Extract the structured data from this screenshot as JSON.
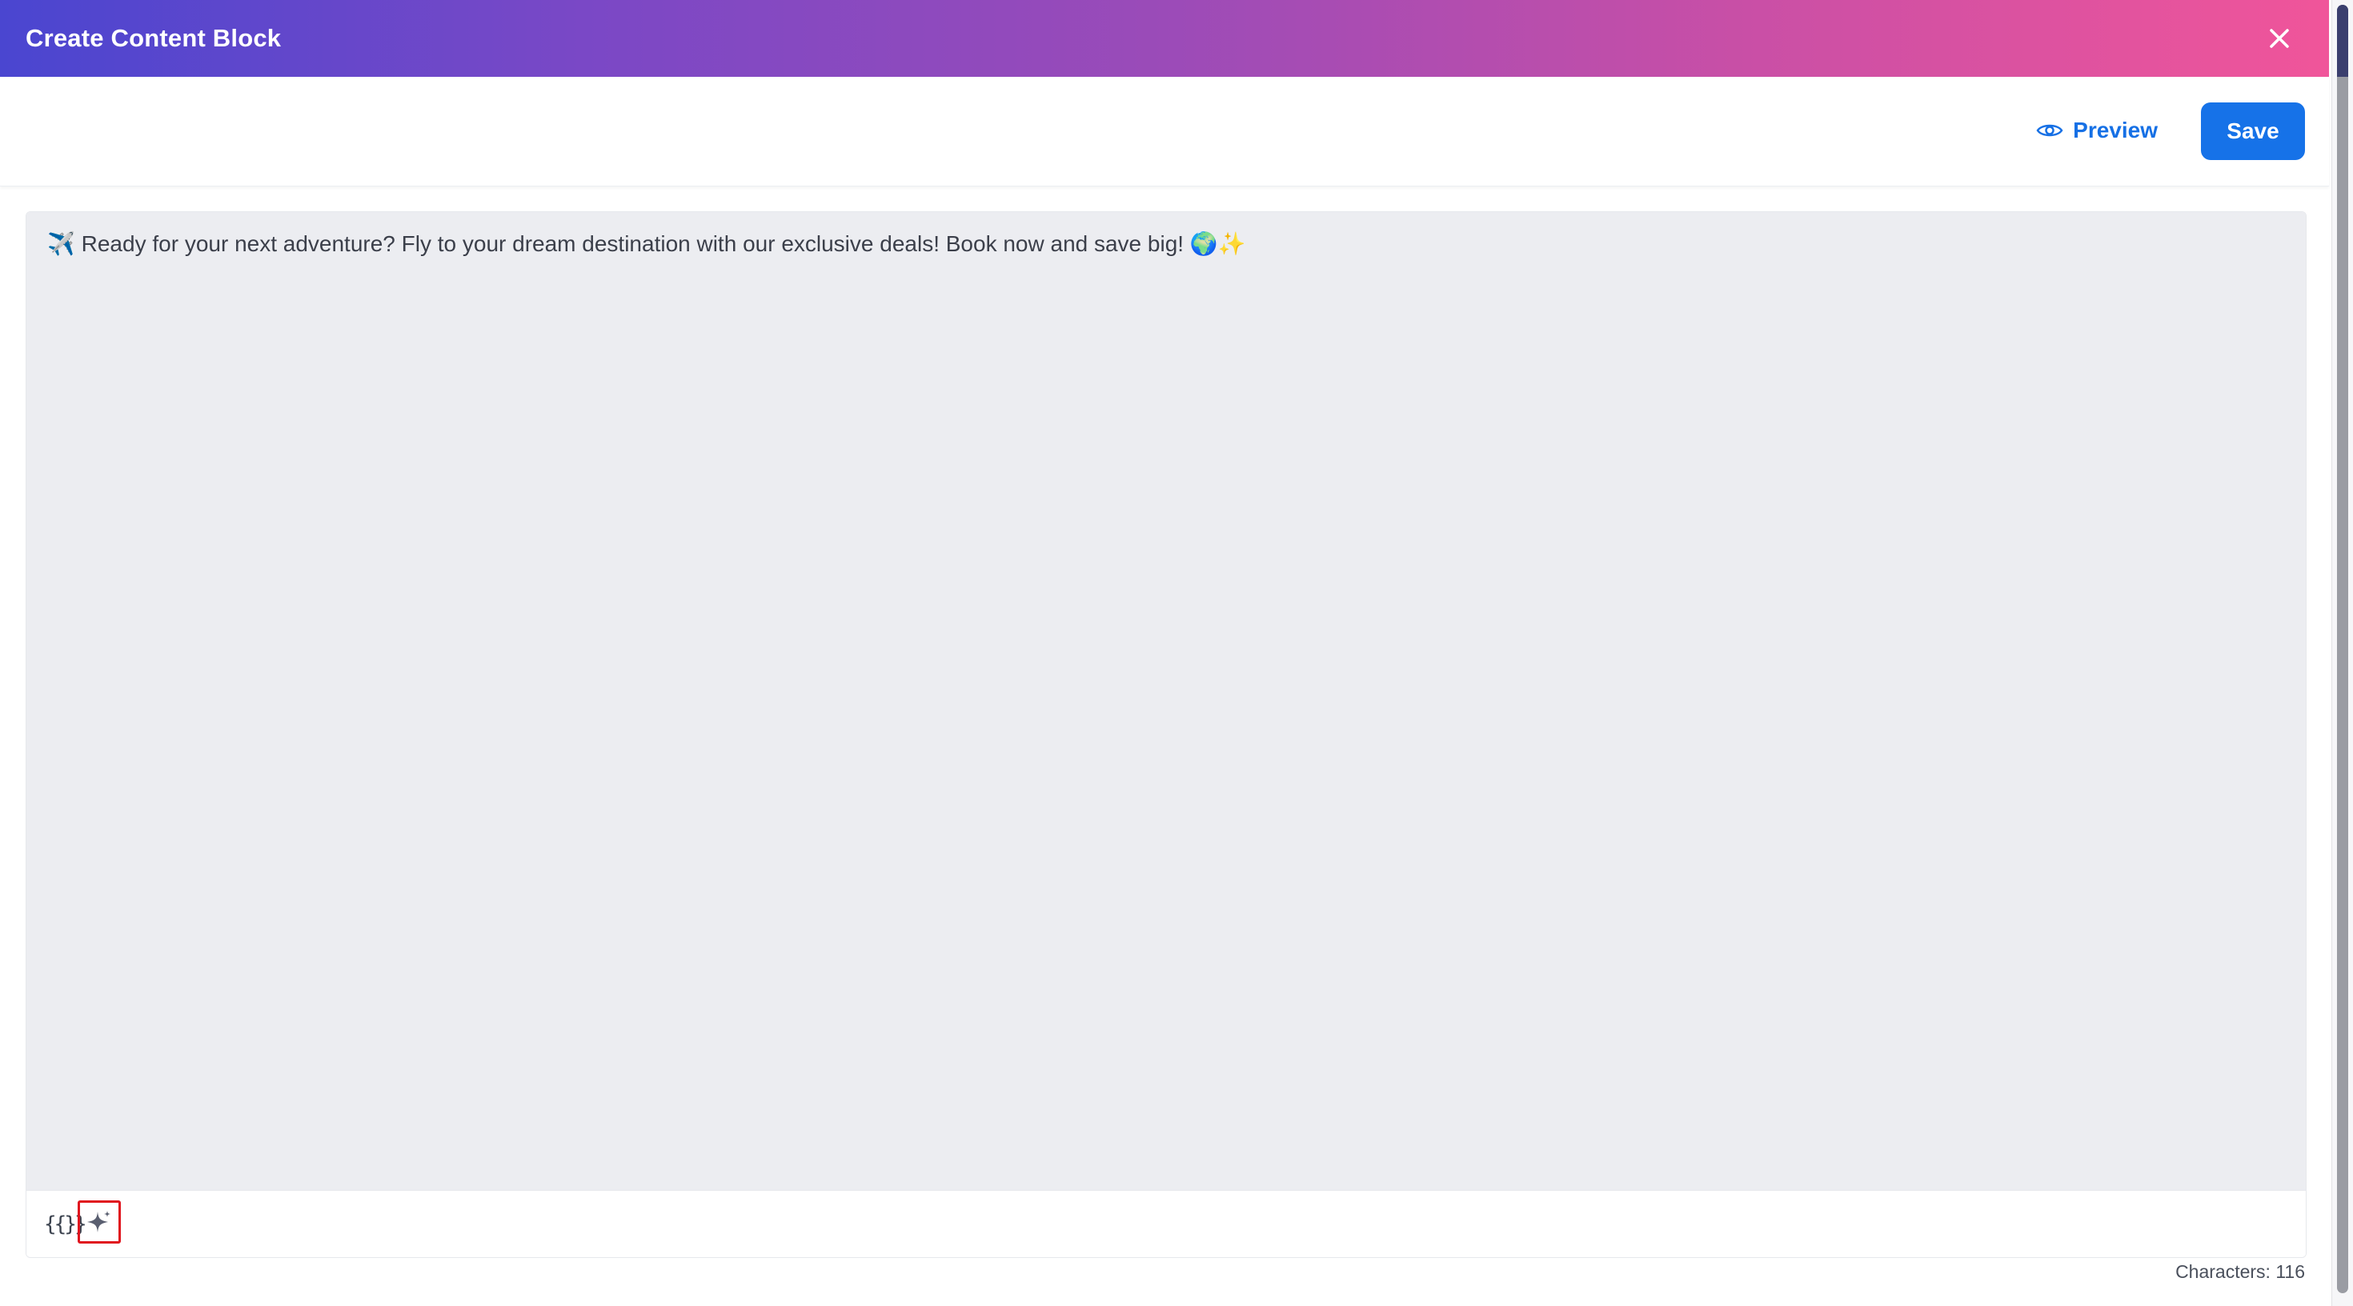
{
  "modal": {
    "title": "Create Content Block"
  },
  "toolbar": {
    "preview_label": "Preview",
    "save_label": "Save"
  },
  "editor": {
    "content": "✈️ Ready for your next adventure? Fly to your dream destination with our exclusive deals! Book now and save big! 🌍✨",
    "variables_label": "{{}}",
    "character_count": "Characters: 116"
  },
  "icons": {
    "close": "close-icon",
    "preview": "eye-icon",
    "ai": "sparkle-icon"
  },
  "colors": {
    "header_gradient_start": "#4a46d0",
    "header_gradient_end": "#f0559a",
    "primary": "#1672e8",
    "editor_background": "#ecedf1",
    "highlight_border": "#e0141e"
  }
}
